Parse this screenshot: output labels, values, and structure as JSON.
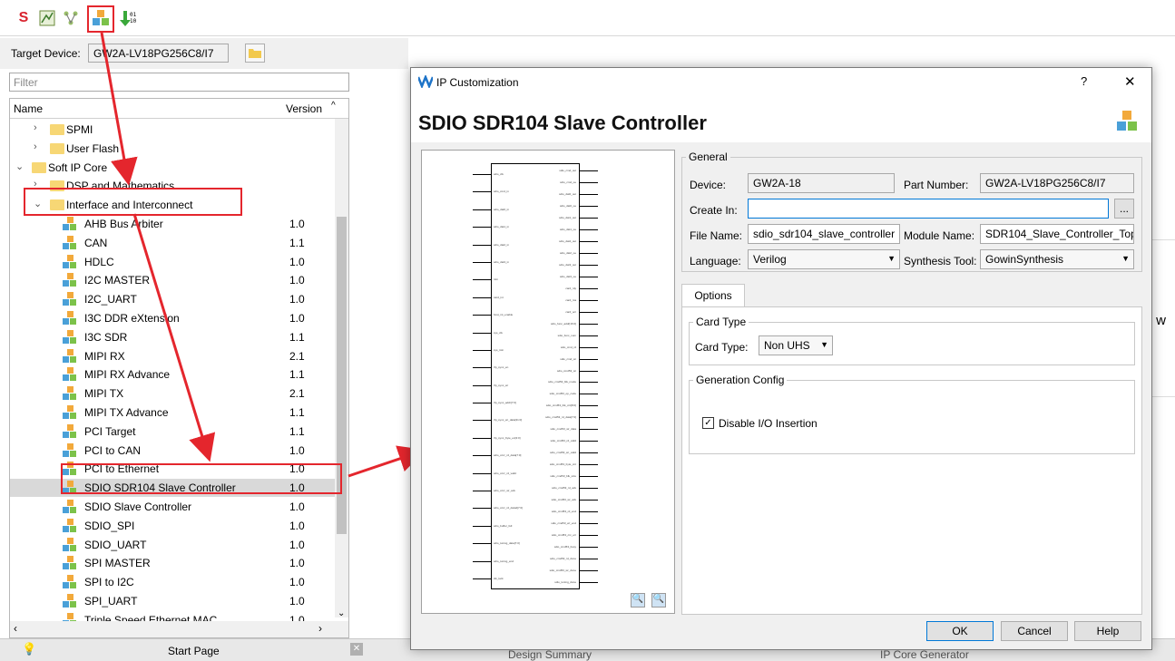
{
  "toolbar": {
    "icons": [
      "gowin-logo-icon",
      "timing-icon",
      "netlist-icon",
      "ip-core-generator-icon",
      "programmer-icon"
    ]
  },
  "target": {
    "label": "Target Device:",
    "value": "GW2A-LV18PG256C8/I7"
  },
  "filter": {
    "placeholder": "Filter"
  },
  "tree": {
    "col_name": "Name",
    "col_version": "Version",
    "rows": [
      {
        "name": "SPMI",
        "version": "",
        "level": 1,
        "type": "folder",
        "expanded": false
      },
      {
        "name": "User Flash",
        "version": "",
        "level": 1,
        "type": "folder",
        "expanded": false
      },
      {
        "name": "Soft IP Core",
        "version": "",
        "level": 0,
        "type": "folder",
        "expanded": true
      },
      {
        "name": "DSP and Mathematics",
        "version": "",
        "level": 1,
        "type": "folder",
        "expanded": false
      },
      {
        "name": "Interface and Interconnect",
        "version": "",
        "level": 1,
        "type": "folder",
        "expanded": true
      },
      {
        "name": "AHB Bus Arbiter",
        "version": "1.0",
        "level": 2,
        "type": "ip"
      },
      {
        "name": "CAN",
        "version": "1.1",
        "level": 2,
        "type": "ip"
      },
      {
        "name": "HDLC",
        "version": "1.0",
        "level": 2,
        "type": "ip"
      },
      {
        "name": "I2C MASTER",
        "version": "1.0",
        "level": 2,
        "type": "ip"
      },
      {
        "name": "I2C_UART",
        "version": "1.0",
        "level": 2,
        "type": "ip"
      },
      {
        "name": "I3C DDR eXtension",
        "version": "1.0",
        "level": 2,
        "type": "ip"
      },
      {
        "name": "I3C SDR",
        "version": "1.1",
        "level": 2,
        "type": "ip"
      },
      {
        "name": "MIPI RX",
        "version": "2.1",
        "level": 2,
        "type": "ip"
      },
      {
        "name": "MIPI RX Advance",
        "version": "1.1",
        "level": 2,
        "type": "ip"
      },
      {
        "name": "MIPI TX",
        "version": "2.1",
        "level": 2,
        "type": "ip"
      },
      {
        "name": "MIPI TX Advance",
        "version": "1.1",
        "level": 2,
        "type": "ip"
      },
      {
        "name": "PCI Target",
        "version": "1.1",
        "level": 2,
        "type": "ip"
      },
      {
        "name": "PCI to CAN",
        "version": "1.0",
        "level": 2,
        "type": "ip"
      },
      {
        "name": "PCI to Ethernet",
        "version": "1.0",
        "level": 2,
        "type": "ip"
      },
      {
        "name": "SDIO SDR104 Slave Controller",
        "version": "1.0",
        "level": 2,
        "type": "ip",
        "selected": true
      },
      {
        "name": "SDIO Slave Controller",
        "version": "1.0",
        "level": 2,
        "type": "ip"
      },
      {
        "name": "SDIO_SPI",
        "version": "1.0",
        "level": 2,
        "type": "ip"
      },
      {
        "name": "SDIO_UART",
        "version": "1.0",
        "level": 2,
        "type": "ip"
      },
      {
        "name": "SPI MASTER",
        "version": "1.0",
        "level": 2,
        "type": "ip"
      },
      {
        "name": "SPI to I2C",
        "version": "1.0",
        "level": 2,
        "type": "ip"
      },
      {
        "name": "SPI_UART",
        "version": "1.0",
        "level": 2,
        "type": "ip"
      },
      {
        "name": "Triple Speed Ethernet MAC",
        "version": "1.0",
        "level": 2,
        "type": "ip"
      }
    ]
  },
  "bottom_tabs": {
    "start_page": "Start Page",
    "design_summary": "Design Summary",
    "ip_core_generator": "IP Core Generator"
  },
  "right_partial_text": "r w",
  "dialog": {
    "title": "IP Customization",
    "help_btn": "?",
    "close_btn": "✕",
    "heading": "SDIO SDR104 Slave Controller",
    "general": {
      "title": "General",
      "device_label": "Device:",
      "device_value": "GW2A-18",
      "part_label": "Part Number:",
      "part_value": "GW2A-LV18PG256C8/I7",
      "create_in_label": "Create In:",
      "create_in_value": "",
      "browse_label": "...",
      "file_name_label": "File Name:",
      "file_name_value": "sdio_sdr104_slave_controller",
      "module_name_label": "Module Name:",
      "module_name_value": "SDR104_Slave_Controller_Top",
      "language_label": "Language:",
      "language_value": "Verilog",
      "synthesis_label": "Synthesis Tool:",
      "synthesis_value": "GowinSynthesis"
    },
    "options_tab": "Options",
    "card_type": {
      "title": "Card Type",
      "label": "Card Type:",
      "value": "Non UHS"
    },
    "generation": {
      "title": "Generation Config",
      "checkbox_label": "Disable I/O Insertion",
      "checked": true
    },
    "buttons": {
      "ok": "OK",
      "cancel": "Cancel",
      "help": "Help"
    },
    "symbol": {
      "left_pins": [
        "sdio_clk",
        "sdio_cmd_in",
        "sdio_dat0_in",
        "sdio_dat1_in",
        "sdio_dat2_in",
        "sdio_dat3_in",
        "rstn",
        "card_int",
        "host_int_enable",
        "sys_clk",
        "sys_rstn",
        "rfp_sync_en",
        "rfp_sync_wr",
        "rfp_sync_addr[7:0]",
        "rfp_sync_wr_data[31:0]",
        "rfp_sync_byte_en[3:0]",
        "sdio_cccr_rd_data[7:0]",
        "sdio_cccr_rd_valid",
        "sdio_cccr_wr_ack",
        "sdio_cccr_rd_data2[7:0]",
        "sdio_buffer_full",
        "sdio_tuning_data[7:0]",
        "sdio_tuning_end",
        "clk_lock"
      ],
      "right_pins": [
        "sdio_cmd_out",
        "sdio_cmd_oe",
        "sdio_dat0_out",
        "sdio_dat0_oe",
        "sdio_dat1_out",
        "sdio_dat1_oe",
        "sdio_dat2_out",
        "sdio_dat2_oe",
        "sdio_dat3_out",
        "sdio_dat3_oe",
        "card_rdy",
        "card_rca",
        "card_ocr",
        "sdio_func_addr[16:0]",
        "sdio_func_num",
        "sdio_cmd_rd",
        "sdio_cmd_wr",
        "sdio_cmd53_wr",
        "sdio_cmd53_blk_mode",
        "sdio_cmd53_op_code",
        "sdio_cmd53_blk_cnt[8:0]",
        "sdio_cmd53_rd_data[7:0]",
        "sdio_cmd53_wr_data",
        "sdio_cmd53_rd_valid",
        "sdio_cmd53_wr_valid",
        "sdio_cmd53_byte_cnt",
        "sdio_cmd53_blk_size",
        "sdio_cmd53_rd_ack",
        "sdio_cmd53_wr_ack",
        "sdio_cmd53_rd_end",
        "sdio_cmd53_wr_end",
        "sdio_cmd53_crc_err",
        "sdio_cmd53_busy",
        "sdio_cmd53_rd_done",
        "sdio_cmd53_wr_done",
        "sdio_tuning_done"
      ]
    }
  }
}
